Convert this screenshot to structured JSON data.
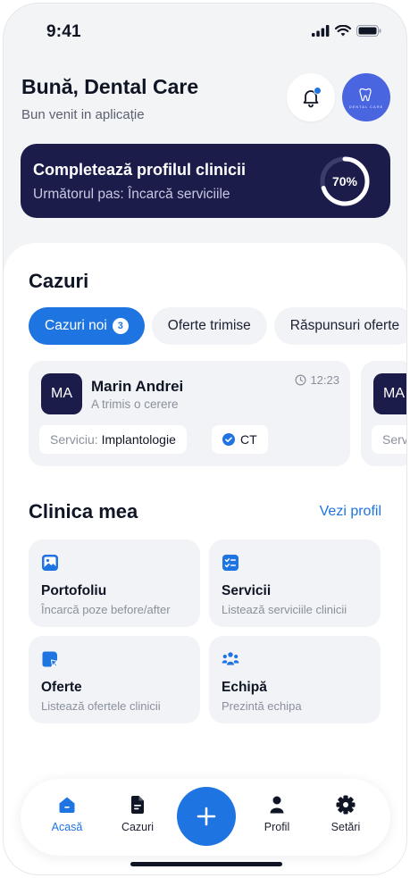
{
  "status_bar": {
    "time": "9:41"
  },
  "header": {
    "greeting": "Bună, Dental Care",
    "subtitle": "Bun venit in aplicație",
    "avatar_text": "DENTAL CARE"
  },
  "progress_card": {
    "title": "Completează profilul clinicii",
    "subtitle": "Următorul pas: Încarcă serviciile",
    "percent_label": "70%",
    "percent_value": 0.7
  },
  "cases": {
    "title": "Cazuri",
    "tabs": [
      {
        "label": "Cazuri noi",
        "badge": "3"
      },
      {
        "label": "Oferte trimise"
      },
      {
        "label": "Răspunsuri oferte"
      }
    ],
    "cards": [
      {
        "initials": "MA",
        "name": "Marin Andrei",
        "status": "A trimis o cerere",
        "time": "12:23",
        "service_label": "Serviciu:",
        "service_value": "Implantologie",
        "tag": "CT"
      },
      {
        "initials": "MA",
        "service_label": "Serv"
      }
    ]
  },
  "clinic": {
    "title": "Clinica mea",
    "see_profile": "Vezi profil",
    "tiles": [
      {
        "title": "Portofoliu",
        "subtitle": "Încarcă poze before/after",
        "icon": "image-icon"
      },
      {
        "title": "Servicii",
        "subtitle": "Listează serviciile clinicii",
        "icon": "checklist-icon"
      },
      {
        "title": "Oferte",
        "subtitle": "Listează ofertele clinicii",
        "icon": "offer-icon"
      },
      {
        "title": "Echipă",
        "subtitle": "Prezintă echipa",
        "icon": "team-icon"
      }
    ]
  },
  "nav": {
    "items": [
      {
        "label": "Acasă",
        "icon": "home-icon",
        "active": true
      },
      {
        "label": "Cazuri",
        "icon": "document-icon"
      },
      {
        "label": "Profil",
        "icon": "user-icon"
      },
      {
        "label": "Setări",
        "icon": "gear-icon"
      }
    ],
    "fab_icon": "plus-icon"
  },
  "colors": {
    "accent": "#1e74e0",
    "navy": "#1b1c4a",
    "avatar": "#4a65e0",
    "surface": "#f1f3f6"
  }
}
